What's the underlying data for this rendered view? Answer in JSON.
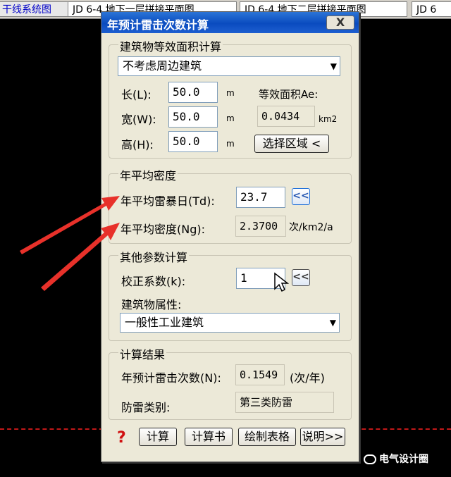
{
  "tabs": [
    "干线系统图",
    "JD 6-4 地下一层拼接平面图",
    "JD 6-4 地下二层拼接平面图",
    "JD 6"
  ],
  "dialog": {
    "title": "年预计雷击次数计算",
    "close_label": "X",
    "equiv_area": {
      "group_label": "建筑物等效面积计算",
      "surrounding_option": "不考虑周边建筑",
      "length_label": "长(L):",
      "length_value": "50.0",
      "width_label": "宽(W):",
      "width_value": "50.0",
      "height_label": "高(H):",
      "height_value": "50.0",
      "unit_m": "m",
      "ae_label": "等效面积Ae:",
      "ae_value": "0.0434",
      "ae_unit": "km2",
      "select_region_label": "选择区域 <"
    },
    "density": {
      "group_label": "年平均密度",
      "td_label": "年平均雷暴日(Td):",
      "td_value": "23.7",
      "ng_label": "年平均密度(Ng):",
      "ng_value": "2.3700",
      "ng_unit": "次/km2/a",
      "pick_label": "<<"
    },
    "other": {
      "group_label": "其他参数计算",
      "k_label": "校正系数(k):",
      "k_value": "1",
      "pick_label": "<<",
      "attr_label": "建筑物属性:",
      "attr_option": "一般性工业建筑"
    },
    "result": {
      "group_label": "计算结果",
      "n_label": "年预计雷击次数(N):",
      "n_value": "0.1549",
      "n_unit": "(次/年)",
      "class_label": "防雷类别:",
      "class_value": "第三类防雷"
    },
    "buttons": {
      "help": "?",
      "calc": "计算",
      "report": "计算书",
      "table": "绘制表格",
      "explain": "说明>>"
    }
  },
  "watermark": "电气设计圈",
  "colors": {
    "title_bar": "#0a4bbf",
    "arrow": "#e8312a",
    "help": "#d01010"
  }
}
